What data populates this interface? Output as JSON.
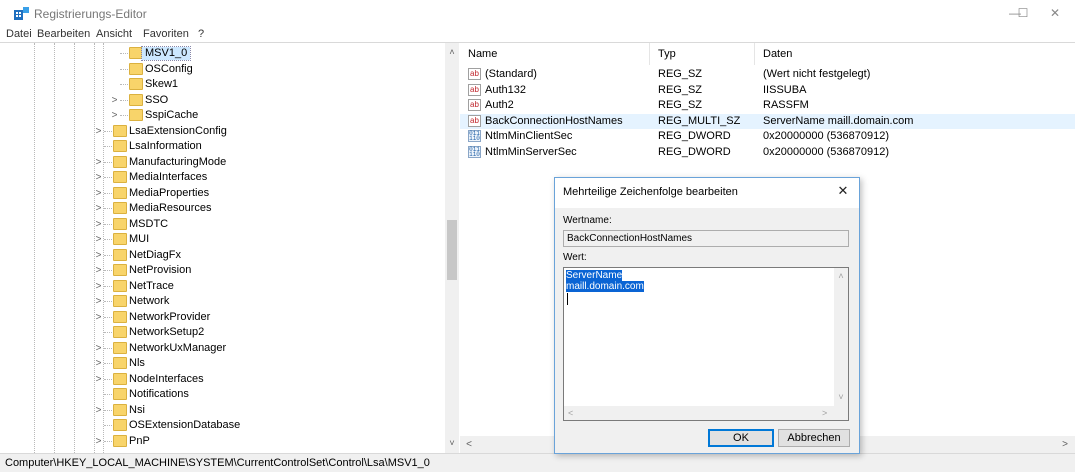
{
  "window": {
    "title": "Registrierungs-Editor",
    "minimize": "—",
    "maximize": "☐",
    "close": "✕"
  },
  "menu": [
    "Datei",
    "Bearbeiten",
    "Ansicht",
    "Favoriten",
    "?"
  ],
  "tree": {
    "items": [
      {
        "label": "MSV1_0",
        "expander": "",
        "level": 2,
        "selected": true
      },
      {
        "label": "OSConfig",
        "expander": "",
        "level": 2
      },
      {
        "label": "Skew1",
        "expander": "",
        "level": 2
      },
      {
        "label": "SSO",
        "expander": ">",
        "level": 2
      },
      {
        "label": "SspiCache",
        "expander": ">",
        "level": 2
      },
      {
        "label": "LsaExtensionConfig",
        "expander": ">",
        "level": 1
      },
      {
        "label": "LsaInformation",
        "expander": "",
        "level": 1
      },
      {
        "label": "ManufacturingMode",
        "expander": ">",
        "level": 1
      },
      {
        "label": "MediaInterfaces",
        "expander": ">",
        "level": 1
      },
      {
        "label": "MediaProperties",
        "expander": ">",
        "level": 1
      },
      {
        "label": "MediaResources",
        "expander": ">",
        "level": 1
      },
      {
        "label": "MSDTC",
        "expander": ">",
        "level": 1
      },
      {
        "label": "MUI",
        "expander": ">",
        "level": 1
      },
      {
        "label": "NetDiagFx",
        "expander": ">",
        "level": 1
      },
      {
        "label": "NetProvision",
        "expander": ">",
        "level": 1
      },
      {
        "label": "NetTrace",
        "expander": ">",
        "level": 1
      },
      {
        "label": "Network",
        "expander": ">",
        "level": 1
      },
      {
        "label": "NetworkProvider",
        "expander": ">",
        "level": 1
      },
      {
        "label": "NetworkSetup2",
        "expander": "",
        "level": 1
      },
      {
        "label": "NetworkUxManager",
        "expander": ">",
        "level": 1
      },
      {
        "label": "Nls",
        "expander": ">",
        "level": 1
      },
      {
        "label": "NodeInterfaces",
        "expander": ">",
        "level": 1
      },
      {
        "label": "Notifications",
        "expander": "",
        "level": 1
      },
      {
        "label": "Nsi",
        "expander": ">",
        "level": 1
      },
      {
        "label": "OSExtensionDatabase",
        "expander": "",
        "level": 1
      },
      {
        "label": "PnP",
        "expander": ">",
        "level": 1
      }
    ],
    "scroll_up": "˄",
    "scroll_down": "˅"
  },
  "list": {
    "columns": [
      "Name",
      "Typ",
      "Daten"
    ],
    "rows": [
      {
        "icon": "ab",
        "name": "(Standard)",
        "type": "REG_SZ",
        "data": "(Wert nicht festgelegt)"
      },
      {
        "icon": "ab",
        "name": "Auth132",
        "type": "REG_SZ",
        "data": "IISSUBA"
      },
      {
        "icon": "ab",
        "name": "Auth2",
        "type": "REG_SZ",
        "data": "RASSFM"
      },
      {
        "icon": "ab",
        "name": "BackConnectionHostNames",
        "type": "REG_MULTI_SZ",
        "data": "ServerName maill.domain.com",
        "selected": true
      },
      {
        "icon": "bin",
        "name": "NtlmMinClientSec",
        "type": "REG_DWORD",
        "data": "0x20000000 (536870912)"
      },
      {
        "icon": "bin",
        "name": "NtlmMinServerSec",
        "type": "REG_DWORD",
        "data": "0x20000000 (536870912)"
      }
    ],
    "scroll_left": "<",
    "scroll_right": ">"
  },
  "status": {
    "path": "Computer\\HKEY_LOCAL_MACHINE\\SYSTEM\\CurrentControlSet\\Control\\Lsa\\MSV1_0"
  },
  "dialog": {
    "title": "Mehrteilige Zeichenfolge bearbeiten",
    "close": "✕",
    "name_label": "Wertname:",
    "name_value": "BackConnectionHostNames",
    "value_label": "Wert:",
    "value_lines": [
      "ServerName",
      "maill.domain.com"
    ],
    "ok": "OK",
    "cancel": "Abbrechen",
    "scroll_up": "˄",
    "scroll_down": "˅",
    "scroll_left": "<",
    "scroll_right": ">"
  },
  "icons": {
    "ab": "ab",
    "bin": "011\n110"
  },
  "colors": {
    "selection": "#0a64d4",
    "row_highlight": "#e5f3ff",
    "folder": "#f8d46a",
    "ok_border": "#0078d7"
  }
}
